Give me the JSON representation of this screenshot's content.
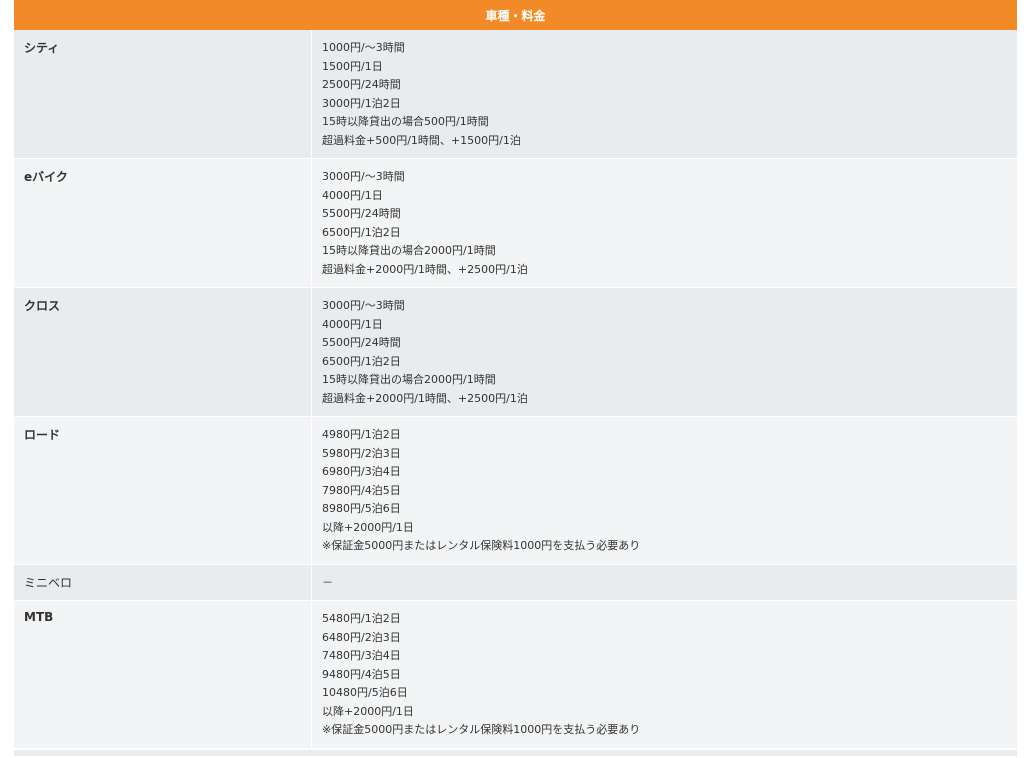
{
  "header": {
    "title": "車種・料金"
  },
  "rows": [
    {
      "name": "シティ",
      "lines": [
        "1000円/～3時間",
        "1500円/1日",
        "2500円/24時間",
        "3000円/1泊2日",
        "15時以降貸出の場合500円/1時間",
        "超過料金+500円/1時間、+1500円/1泊"
      ]
    },
    {
      "name": "eバイク",
      "lines": [
        "3000円/～3時間",
        "4000円/1日",
        "5500円/24時間",
        "6500円/1泊2日",
        "15時以降貸出の場合2000円/1時間",
        "超過料金+2000円/1時間、+2500円/1泊"
      ]
    },
    {
      "name": "クロス",
      "lines": [
        "3000円/～3時間",
        "4000円/1日",
        "5500円/24時間",
        "6500円/1泊2日",
        "15時以降貸出の場合2000円/1時間",
        "超過料金+2000円/1時間、+2500円/1泊"
      ]
    },
    {
      "name": "ロード",
      "lines": [
        "4980円/1泊2日",
        "5980円/2泊3日",
        "6980円/3泊4日",
        "7980円/4泊5日",
        "8980円/5泊6日",
        "以降+2000円/1日",
        "※保証金5000円またはレンタル保険料1000円を支払う必要あり"
      ]
    },
    {
      "name": "ミニベロ",
      "lines": [
        "－"
      ]
    },
    {
      "name": "MTB",
      "lines": [
        "5480円/1泊2日",
        "6480円/2泊3日",
        "7480円/3泊4日",
        "9480円/4泊5日",
        "10480円/5泊6日",
        "以降+2000円/1日",
        "※保証金5000円またはレンタル保険料1000円を支払う必要あり"
      ]
    }
  ]
}
